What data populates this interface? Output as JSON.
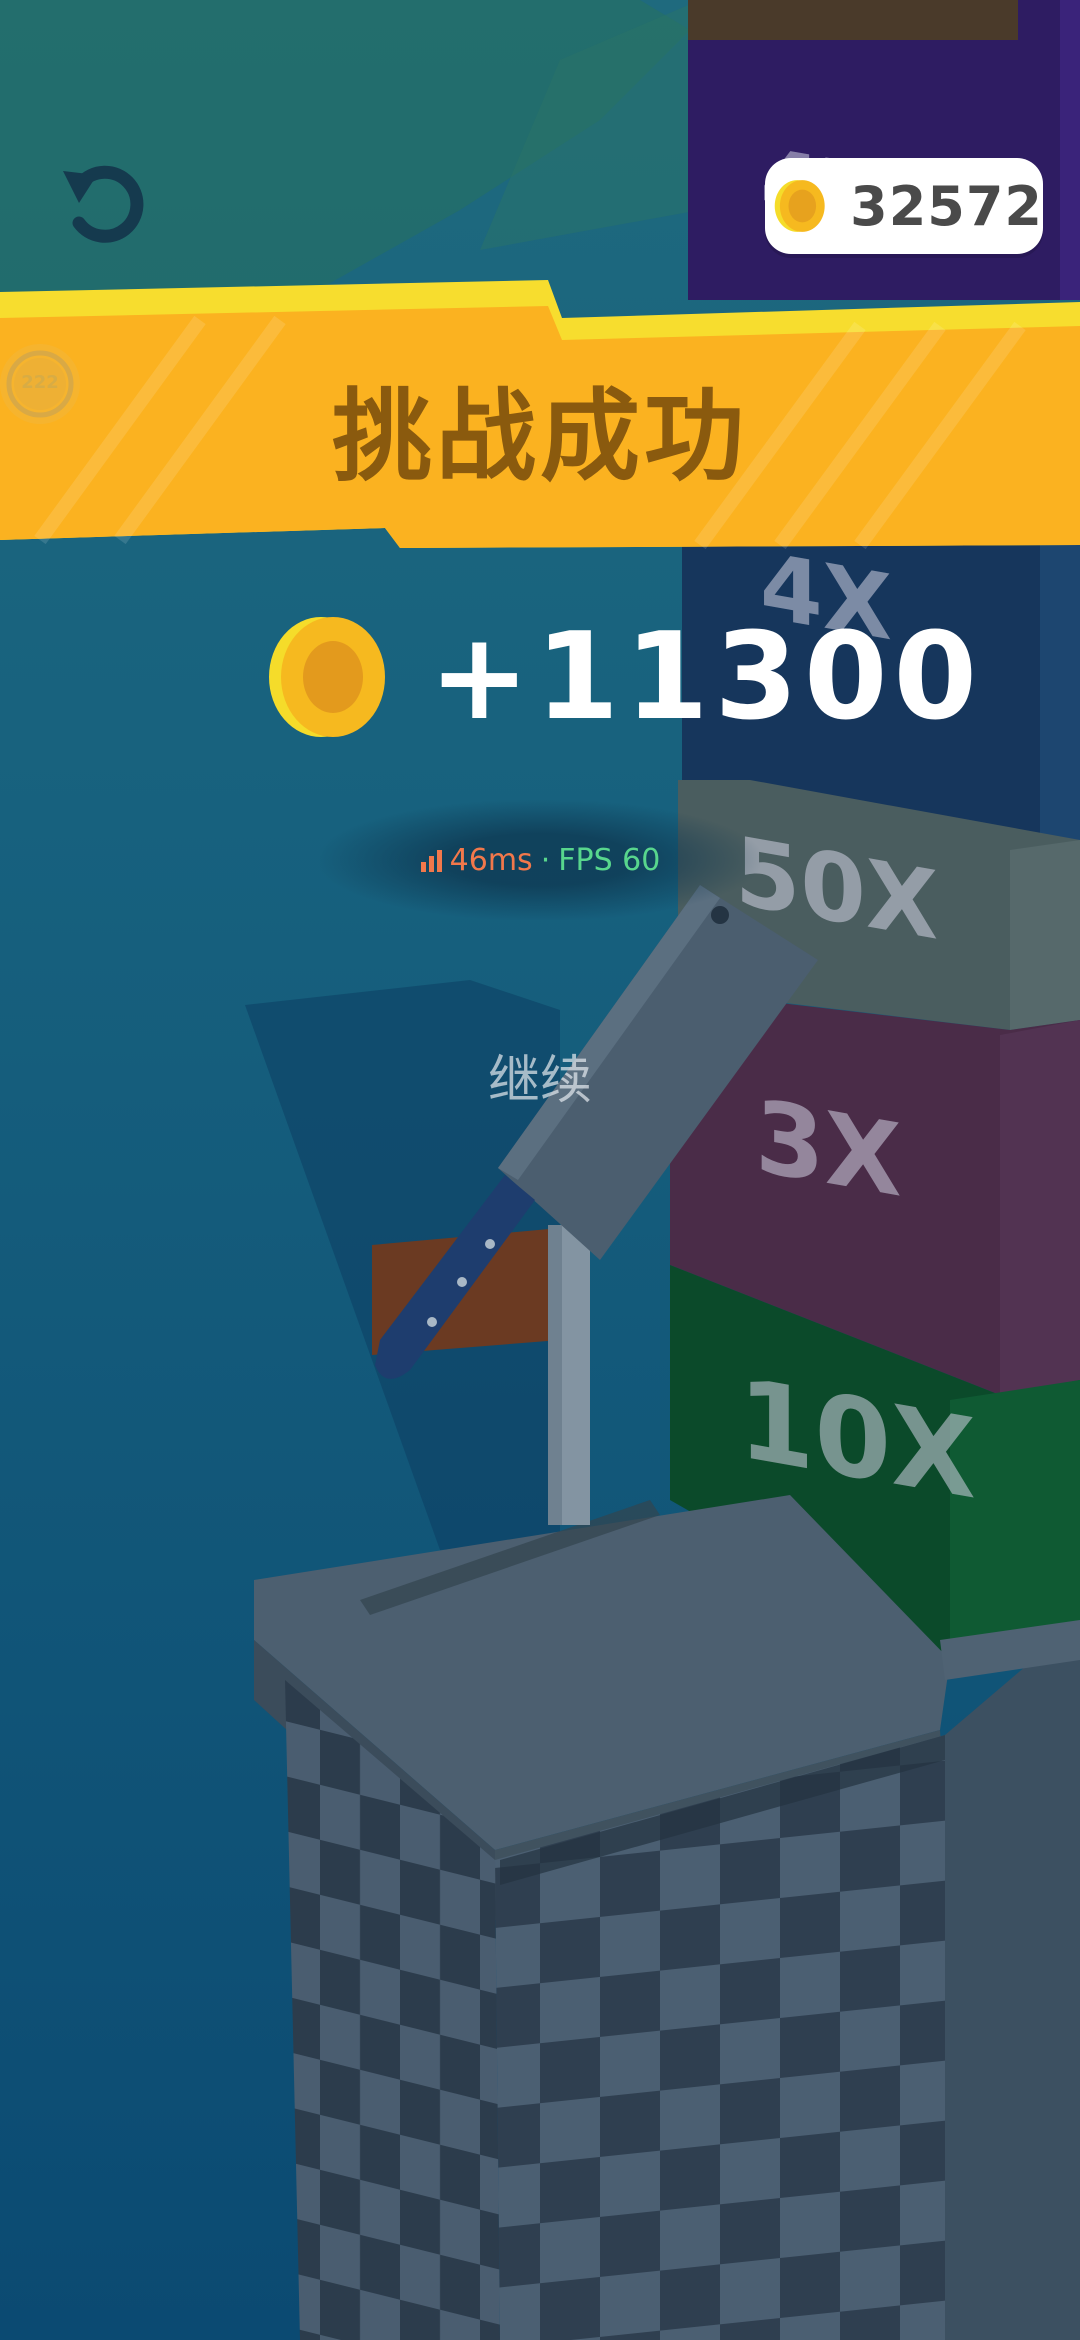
{
  "hud": {
    "restart_icon": "restart-icon",
    "coin_icon": "coin-icon",
    "coins": "32572"
  },
  "banner": {
    "title": "挑战成功",
    "badge_icon": "clock-icon",
    "badge_text": "222",
    "colors": {
      "main": "#fbb220",
      "highlight": "#f7dd2e",
      "text": "#8a5a0e"
    }
  },
  "reward": {
    "coin_icon": "coin-icon",
    "amount": "+11300"
  },
  "perf": {
    "signal_icon": "signal-bars-icon",
    "ping": "46ms",
    "separator": "·",
    "fps": "FPS 60"
  },
  "continue_label": "继续",
  "tower": {
    "blocks": [
      {
        "label": "4X",
        "color": "#16365c"
      },
      {
        "label": "50X",
        "color": "#4a5d5f"
      },
      {
        "label": "3X",
        "color": "#4a2c48"
      },
      {
        "label": "10X",
        "color": "#0b4a2a"
      }
    ],
    "top_block_color": "#2e1c62"
  }
}
